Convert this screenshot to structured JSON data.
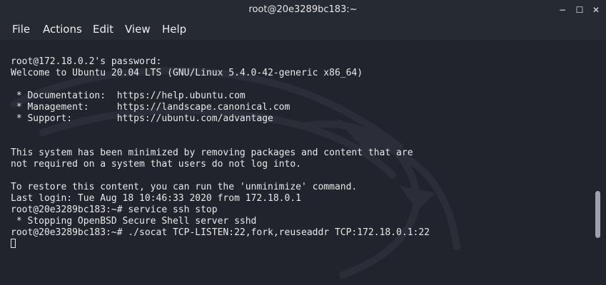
{
  "window": {
    "title": "root@20e3289bc183:~",
    "minimize_glyph": "−",
    "maximize_glyph": "☐",
    "close_glyph": "✕"
  },
  "menu": {
    "items": [
      "File",
      "Actions",
      "Edit",
      "View",
      "Help"
    ]
  },
  "terminal": {
    "lines": [
      "root@172.18.0.2's password:",
      "Welcome to Ubuntu 20.04 LTS (GNU/Linux 5.4.0-42-generic x86_64)",
      "",
      " * Documentation:  https://help.ubuntu.com",
      " * Management:     https://landscape.canonical.com",
      " * Support:        https://ubuntu.com/advantage",
      "",
      "",
      "This system has been minimized by removing packages and content that are",
      "not required on a system that users do not log into.",
      "",
      "To restore this content, you can run the 'unminimize' command.",
      "Last login: Tue Aug 18 10:46:33 2020 from 172.18.0.1",
      "root@20e3289bc183:~# service ssh stop",
      " * Stopping OpenBSD Secure Shell server sshd",
      "root@20e3289bc183:~# ./socat TCP-LISTEN:22,fork,reuseaddr TCP:172.18.0.1:22"
    ]
  },
  "colors": {
    "background": "#22242d",
    "chrome": "#262a33",
    "text": "#e8e8e8"
  },
  "icons": {
    "minimize": "minimize-icon",
    "maximize": "maximize-icon",
    "close": "close-icon",
    "cursor": "block-cursor"
  }
}
